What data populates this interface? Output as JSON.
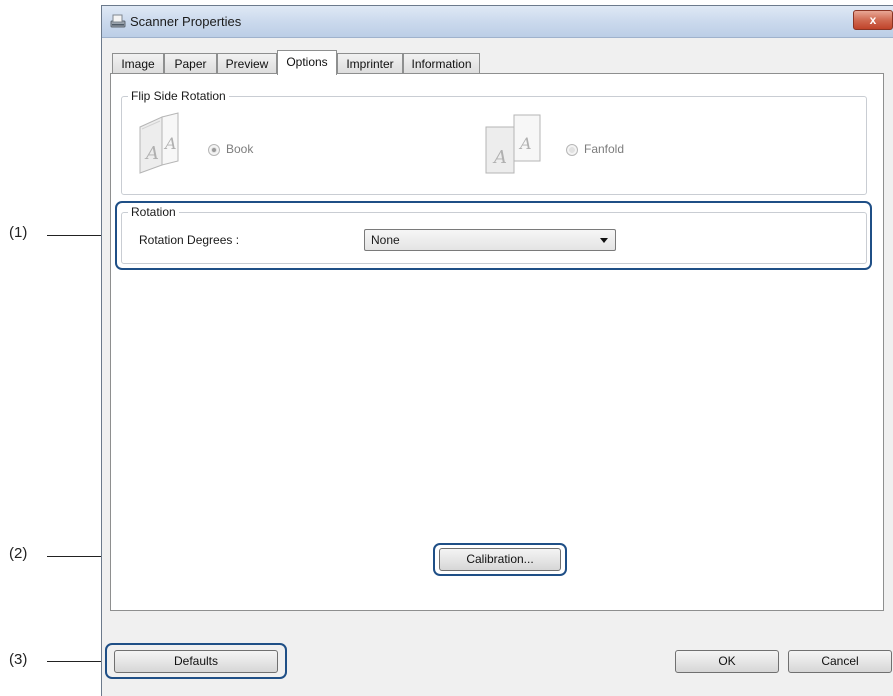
{
  "window": {
    "title": "Scanner Properties",
    "close_label": "x"
  },
  "tabs": [
    {
      "label": "Image"
    },
    {
      "label": "Paper"
    },
    {
      "label": "Preview"
    },
    {
      "label": "Options",
      "active": true
    },
    {
      "label": "Imprinter"
    },
    {
      "label": "Information"
    }
  ],
  "flip_side": {
    "title": "Flip Side Rotation",
    "book_label": "Book",
    "book_selected": true,
    "fanfold_label": "Fanfold",
    "enabled": false
  },
  "rotation": {
    "title": "Rotation",
    "degrees_label": "Rotation Degrees :",
    "degrees_value": "None"
  },
  "buttons": {
    "calibration": "Calibration...",
    "defaults": "Defaults",
    "ok": "OK",
    "cancel": "Cancel"
  },
  "callouts": [
    "(1)",
    "(2)",
    "(3)"
  ],
  "colors": {
    "highlight": "#1f4f86",
    "titlebar": "#c9d8ec",
    "close": "#c0432a"
  }
}
